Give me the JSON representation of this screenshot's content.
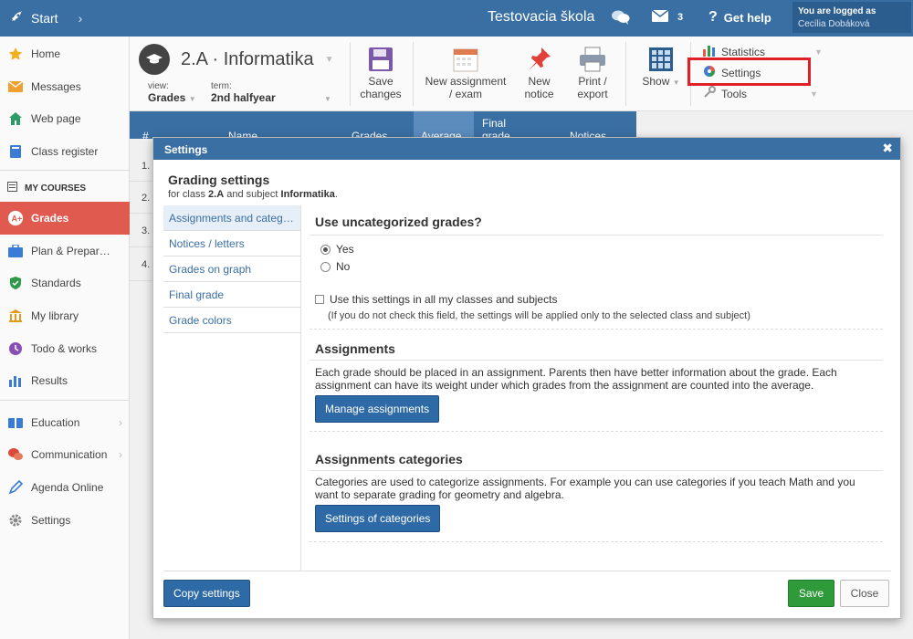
{
  "topbar": {
    "start_label": "Start",
    "school_name": "Testovacia škola",
    "mail_count": "3",
    "help_label": "Get help",
    "logged_label": "You are logged as",
    "user_name": "Cecília Dobáková"
  },
  "sidebar": {
    "items": [
      {
        "label": "Home",
        "icon": "star-icon"
      },
      {
        "label": "Messages",
        "icon": "envelope-icon"
      },
      {
        "label": "Web page",
        "icon": "house-icon"
      },
      {
        "label": "Class register",
        "icon": "book-icon"
      }
    ],
    "courses_heading": "MY COURSES",
    "course_items": [
      {
        "label": "Grades",
        "icon": "grades-icon",
        "active": true
      },
      {
        "label": "Plan & Prepar…",
        "icon": "briefcase-icon"
      },
      {
        "label": "Standards",
        "icon": "shield-check-icon"
      },
      {
        "label": "My library",
        "icon": "library-icon"
      },
      {
        "label": "Todo & works",
        "icon": "clock-icon"
      },
      {
        "label": "Results",
        "icon": "bar-chart-icon"
      }
    ],
    "other_items": [
      {
        "label": "Education",
        "icon": "education-icon"
      },
      {
        "label": "Communication",
        "icon": "chat-icon"
      },
      {
        "label": "Agenda Online",
        "icon": "pen-icon"
      },
      {
        "label": "Settings",
        "icon": "gear-icon"
      }
    ]
  },
  "toolbar": {
    "class_title": "2.A · Informatika",
    "view_label": "view:",
    "view_value": "Grades",
    "term_label": "term:",
    "term_value": "2nd halfyear",
    "save_line1": "Save",
    "save_line2": "changes",
    "new_assignment_line1": "New assignment",
    "new_assignment_line2": "/ exam",
    "new_notice_line1": "New",
    "new_notice_line2": "notice",
    "print_line1": "Print /",
    "print_line2": "export",
    "show_label": "Show",
    "menu_statistics": "Statistics",
    "menu_settings": "Settings",
    "menu_tools": "Tools"
  },
  "table": {
    "header_hash": "#",
    "header_name": "Name",
    "header_grades": "Grades",
    "header_average": "Average",
    "header_final": "Final grade",
    "header_notices": "Notices",
    "rows": [
      "1.",
      "2.",
      "3.",
      "4."
    ]
  },
  "modal": {
    "header_title": "Settings",
    "title": "Grading settings",
    "sub_prefix": "for class",
    "sub_class": "2.A",
    "sub_middle": "and subject",
    "sub_subject": "Informatika",
    "nav": [
      "Assignments and categories",
      "Notices / letters",
      "Grades on graph",
      "Final grade",
      "Grade colors"
    ],
    "uncat_heading": "Use uncategorized grades?",
    "opt_yes": "Yes",
    "opt_no": "No",
    "use_all_label": "Use this settings in all my classes and subjects",
    "use_all_note": "(If you do not check this field, the settings will be applied only to the selected class and subject)",
    "assign_heading": "Assignments",
    "assign_text": "Each grade should be placed in an assignment. Parents then have better information about the grade. Each assignment can have its weight under which grades from the assignment are counted into the average.",
    "manage_btn": "Manage assignments",
    "cat_heading": "Assignments categories",
    "cat_text": "Categories are used to categorize assignments. For example you can use categories if you teach Math and you want to separate grading for geometry and algebra.",
    "cat_btn": "Settings of categories",
    "copy_btn": "Copy settings",
    "save_btn": "Save",
    "close_btn": "Close"
  },
  "colors": {
    "primary": "#3a6fa3",
    "active_red": "#e05a50",
    "save_green": "#2e9a3a",
    "highlight_red": "#e01f26"
  }
}
